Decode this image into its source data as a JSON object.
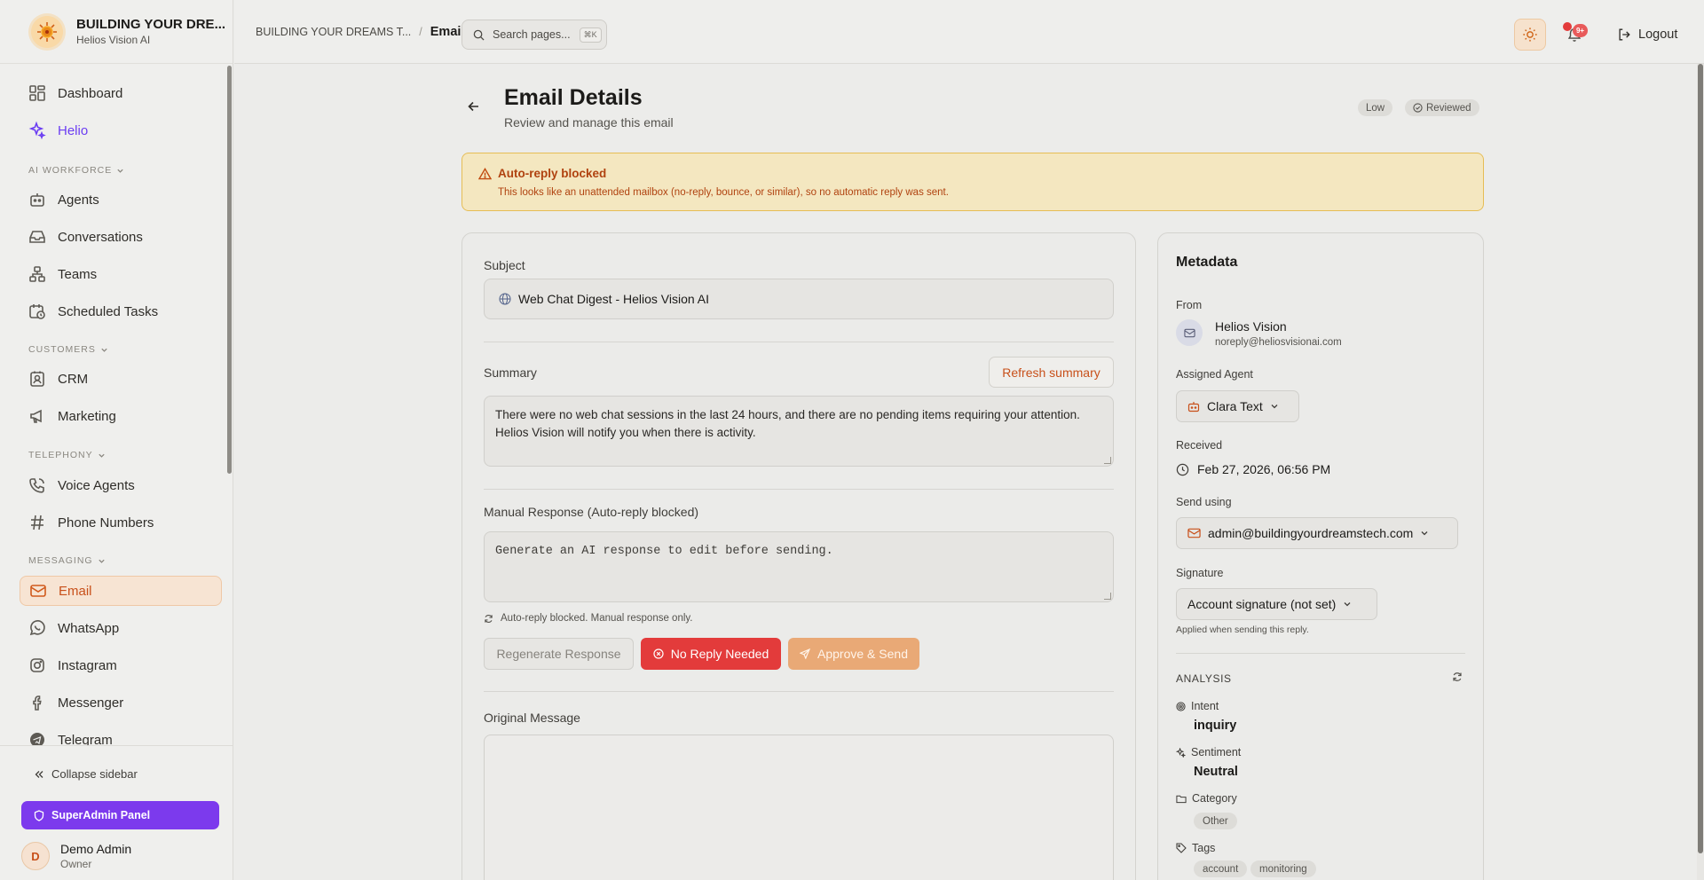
{
  "brand": {
    "title": "BUILDING YOUR DRE...",
    "subtitle": "Helios Vision AI"
  },
  "sidebar": {
    "items": [
      {
        "label": "Dashboard",
        "icon": "grid-icon"
      },
      {
        "label": "Helio",
        "icon": "sparkles-icon"
      },
      {
        "label": "Agents",
        "icon": "robot-icon"
      },
      {
        "label": "Conversations",
        "icon": "inbox-icon"
      },
      {
        "label": "Teams",
        "icon": "network-icon"
      },
      {
        "label": "Scheduled Tasks",
        "icon": "calendar-clock-icon"
      },
      {
        "label": "CRM",
        "icon": "contact-icon"
      },
      {
        "label": "Marketing",
        "icon": "megaphone-icon"
      },
      {
        "label": "Voice Agents",
        "icon": "phone-icon"
      },
      {
        "label": "Phone Numbers",
        "icon": "hash-icon"
      },
      {
        "label": "Email",
        "icon": "mail-icon"
      },
      {
        "label": "WhatsApp",
        "icon": "whatsapp-icon"
      },
      {
        "label": "Instagram",
        "icon": "instagram-icon"
      },
      {
        "label": "Messenger",
        "icon": "facebook-icon"
      },
      {
        "label": "Telegram",
        "icon": "telegram-icon"
      }
    ],
    "sections": {
      "ai_workforce": "AI WORKFORCE",
      "customers": "CUSTOMERS",
      "telephony": "TELEPHONY",
      "messaging": "MESSAGING"
    },
    "collapse_label": "Collapse sidebar",
    "superadmin_label": "SuperAdmin Panel",
    "user": {
      "initial": "D",
      "name": "Demo Admin",
      "role": "Owner"
    }
  },
  "topbar": {
    "breadcrumb_parent": "BUILDING YOUR DREAMS T...",
    "breadcrumb_sep": "/",
    "breadcrumb_current": "Email",
    "search_placeholder": "Search pages...",
    "search_shortcut": "⌘K",
    "notification_count": "9+",
    "logout_label": "Logout"
  },
  "header": {
    "title": "Email Details",
    "subtitle": "Review and manage this email",
    "priority": "Low",
    "status": "Reviewed"
  },
  "alert": {
    "title": "Auto-reply blocked",
    "text": "This looks like an unattended mailbox (no-reply, bounce, or similar), so no automatic reply was sent."
  },
  "email": {
    "subject_label": "Subject",
    "subject": "Web Chat Digest - Helios Vision AI",
    "summary_label": "Summary",
    "refresh_summary_label": "Refresh summary",
    "summary": "There were no web chat sessions in the last 24 hours, and there are no pending items requiring your attention. Helios Vision will notify you when there is activity.",
    "manual_label": "Manual Response (Auto-reply blocked)",
    "manual_placeholder": "Generate an AI response to edit before sending.",
    "hint": "Auto-reply blocked. Manual response only.",
    "regenerate_label": "Regenerate Response",
    "no_reply_label": "No Reply Needed",
    "approve_label": "Approve & Send",
    "original_label": "Original Message"
  },
  "metadata": {
    "title": "Metadata",
    "from_label": "From",
    "from_name": "Helios Vision",
    "from_email": "noreply@heliosvisionai.com",
    "agent_label": "Assigned Agent",
    "agent": "Clara Text",
    "received_label": "Received",
    "received": "Feb 27, 2026, 06:56 PM",
    "send_using_label": "Send using",
    "send_using": "admin@buildingyourdreamstech.com",
    "signature_label": "Signature",
    "signature": "Account signature (not set)",
    "signature_note": "Applied when sending this reply."
  },
  "analysis": {
    "heading": "ANALYSIS",
    "intent_label": "Intent",
    "intent": "inquiry",
    "sentiment_label": "Sentiment",
    "sentiment": "Neutral",
    "category_label": "Category",
    "category": "Other",
    "tags_label": "Tags",
    "tags": [
      "account",
      "monitoring"
    ]
  },
  "colors": {
    "accent": "#c8501a",
    "purple": "#7c3aed",
    "danger": "#e33b3b",
    "alert_bg": "#f4e7c0"
  }
}
